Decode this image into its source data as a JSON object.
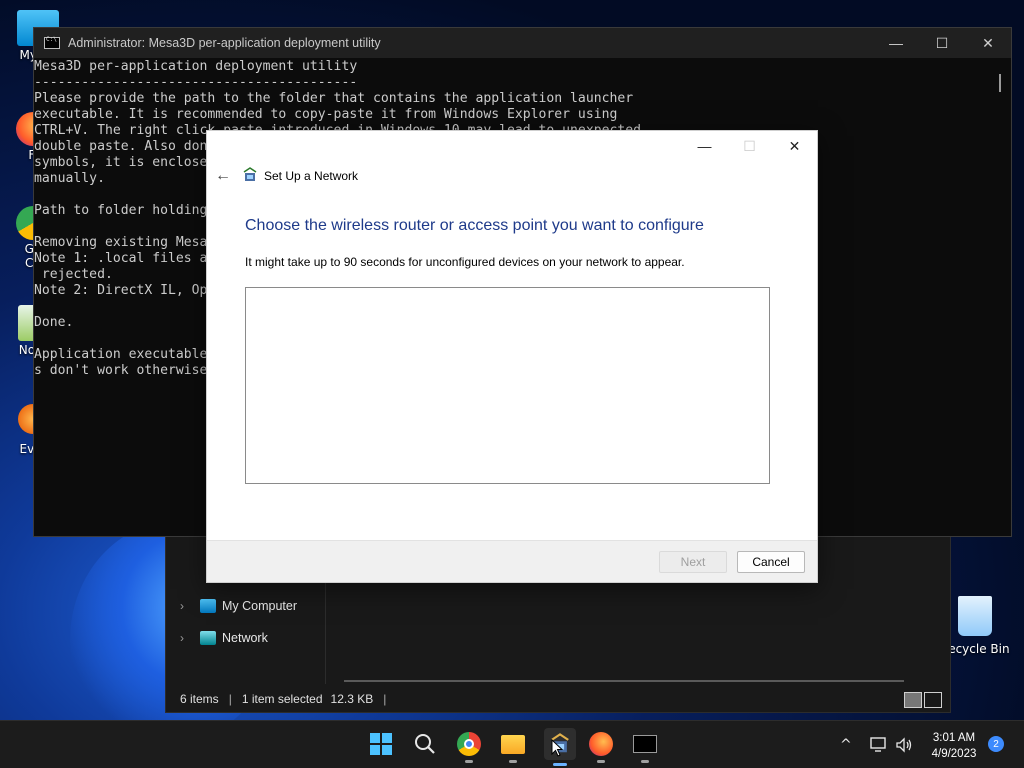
{
  "desktop": {
    "icons": [
      {
        "label": "My Co"
      },
      {
        "label": "Fi"
      },
      {
        "label": "Go",
        "label2": "Ch"
      },
      {
        "label": "Note"
      },
      {
        "label": "Ever"
      },
      {
        "label": "Recycle Bin"
      }
    ]
  },
  "console": {
    "title": "Administrator:  Mesa3D per-application deployment utility",
    "text": "Mesa3D per-application deployment utility\n-----------------------------------------\nPlease provide the path to the folder that contains the application launcher\nexecutable. It is recommended to copy-paste it from Windows Explorer using\nCTRL+V. The right click paste introduced in Windows 10 may lead to unexpected\ndouble paste. Also don                                                      \nsymbols, it is enclose                                                      \nmanually.\n\nPath to folder holding                                                       pot\\bin\\\n\nRemoving existing Mesa\nNote 1: .local files a                                                       p OpenGL deployment is\n rejected.\nNote 2: DirectX IL, Op                                                       symbolic links.\n\nDone.\n\nApplication executable                                                       ly specify it if thing\ns don't work otherwise"
  },
  "explorer": {
    "nav": [
      {
        "label": "My Computer"
      },
      {
        "label": "Network"
      }
    ],
    "status": {
      "items": "6 items",
      "selected": "1 item selected",
      "size": "12.3 KB"
    }
  },
  "dialog": {
    "title": "Set Up a Network",
    "heading": "Choose the wireless router or access point you want to configure",
    "subtext": "It might take up to 90 seconds for unconfigured devices on your network to appear.",
    "next_label": "Next",
    "cancel_label": "Cancel"
  },
  "taskbar": {
    "apps": [
      {
        "icon": "windows-start-icon"
      },
      {
        "icon": "search-icon"
      },
      {
        "icon": "chrome-icon"
      },
      {
        "icon": "file-explorer-icon"
      },
      {
        "icon": "network-setup-icon"
      },
      {
        "icon": "firefox-icon"
      },
      {
        "icon": "terminal-icon"
      }
    ],
    "clock": {
      "time": "3:01 AM",
      "date": "4/9/2023"
    },
    "notifications": "2"
  },
  "colors": {
    "accent": "#1e3a8a",
    "taskbar": "#1c1c1c",
    "console_bg": "#0c0c0c"
  }
}
